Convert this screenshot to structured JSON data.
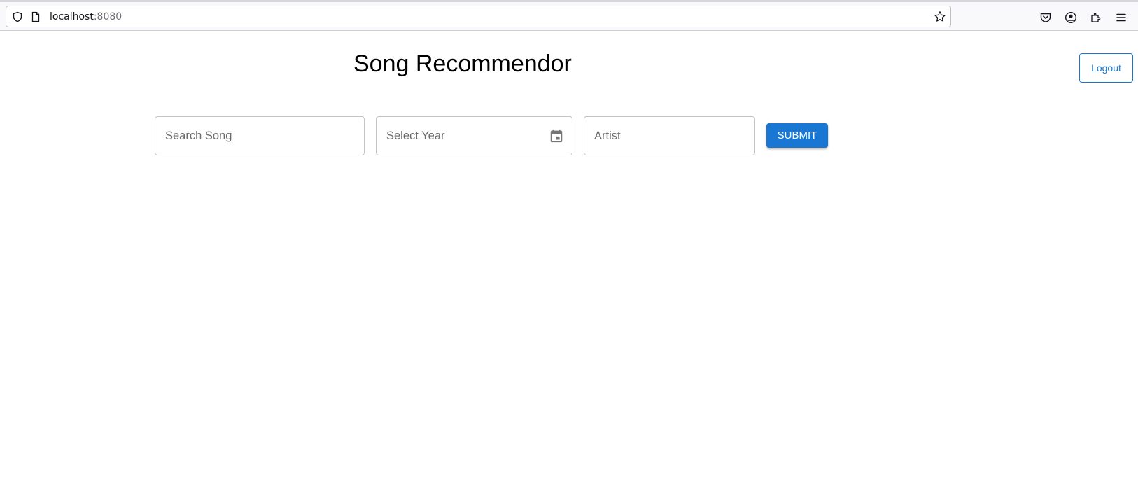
{
  "browser": {
    "url_host": "localhost",
    "url_port": ":8080",
    "icons": [
      "shield-icon",
      "page-icon",
      "star-icon",
      "pocket-icon",
      "account-icon",
      "extensions-icon",
      "menu-icon"
    ]
  },
  "page": {
    "title": "Song Recommendor",
    "logout_label": "Logout"
  },
  "form": {
    "song": {
      "value": "",
      "placeholder": "Search Song"
    },
    "year": {
      "value": "",
      "placeholder": "Select Year",
      "icon": "calendar-icon"
    },
    "artist": {
      "value": "",
      "placeholder": "Artist"
    },
    "submit_label": "SUBMIT"
  },
  "colors": {
    "primary": "#1976d2",
    "field_border": "#c4c4c4",
    "placeholder": "#6b6b6b",
    "background": "#ffffff"
  }
}
